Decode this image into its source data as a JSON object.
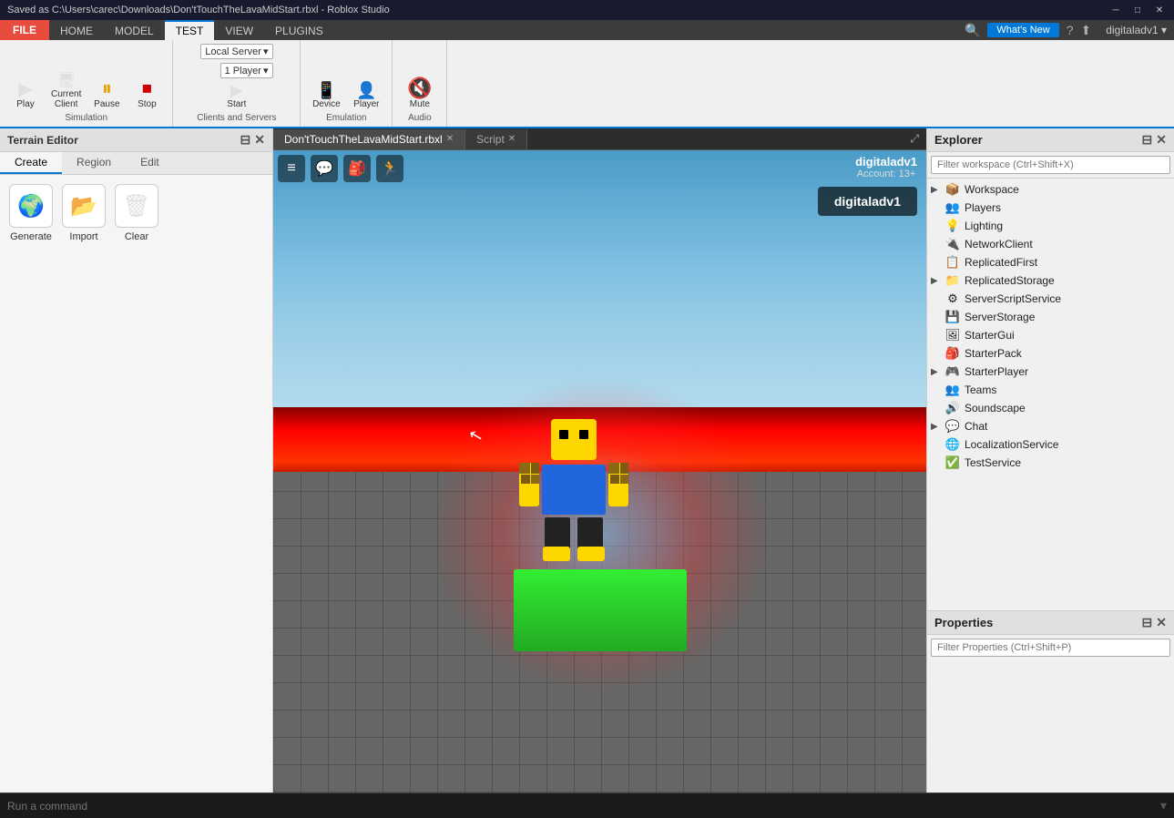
{
  "window": {
    "title": "Saved as C:\\Users\\carec\\Downloads\\Don'tTouchTheLavaMidStart.rbxl - Roblox Studio",
    "minimize": "─",
    "maximize": "□",
    "close": "✕"
  },
  "top_area": {
    "file_label": "FILE",
    "whats_new": "What's New",
    "help_icon": "?",
    "share_icon": "⬆",
    "user": "digitaladv1 ▾"
  },
  "menu": {
    "tabs": [
      "HOME",
      "MODEL",
      "TEST",
      "VIEW",
      "PLUGINS"
    ],
    "active": "TEST"
  },
  "ribbon": {
    "simulation": {
      "label": "Simulation",
      "play": {
        "label": "Play",
        "icon": "▶"
      },
      "current_client": {
        "label": "Current\nClient",
        "icon": "🖥"
      },
      "pause": {
        "label": "Pause",
        "icon": "⏸"
      },
      "stop": {
        "label": "Stop",
        "icon": "⏹"
      }
    },
    "clients_servers": {
      "label": "Clients and Servers",
      "local_server": "Local Server",
      "players": "1 Player",
      "start": {
        "label": "Start",
        "icon": "▶"
      }
    },
    "emulation": {
      "label": "Emulation",
      "device": {
        "label": "Device",
        "icon": "📱"
      },
      "player": {
        "label": "Player",
        "icon": "👤"
      }
    },
    "audio": {
      "label": "Audio",
      "mute": {
        "label": "Mute",
        "icon": "🔇"
      }
    }
  },
  "terrain_editor": {
    "title": "Terrain Editor",
    "tabs": [
      "Create",
      "Region",
      "Edit"
    ],
    "active_tab": "Create",
    "tools": [
      {
        "id": "generate",
        "label": "Generate",
        "icon": "🌍"
      },
      {
        "id": "import",
        "label": "Import",
        "icon": "📂"
      },
      {
        "id": "clear",
        "label": "Clear",
        "icon": "🗑"
      }
    ]
  },
  "viewport": {
    "tabs": [
      {
        "label": "Don'tTouchTheLavaMidStart.rbxl",
        "closeable": true
      },
      {
        "label": "Script",
        "closeable": true
      }
    ],
    "active_tab": 0,
    "ingame": {
      "username": "digitaladv1",
      "account_label": "Account: 13+",
      "button_label": "digitaladv1"
    },
    "toolbar_icons": [
      "≡",
      "💬",
      "🎒",
      "🏃"
    ]
  },
  "explorer": {
    "title": "Explorer",
    "filter_placeholder": "Filter workspace (Ctrl+Shift+X)",
    "items": [
      {
        "label": "Workspace",
        "icon": "📦",
        "expandable": true,
        "indent": 0
      },
      {
        "label": "Players",
        "icon": "👥",
        "expandable": false,
        "indent": 0
      },
      {
        "label": "Lighting",
        "icon": "💡",
        "expandable": false,
        "indent": 0
      },
      {
        "label": "NetworkClient",
        "icon": "🔌",
        "expandable": false,
        "indent": 0
      },
      {
        "label": "ReplicatedFirst",
        "icon": "📋",
        "expandable": false,
        "indent": 0
      },
      {
        "label": "ReplicatedStorage",
        "icon": "📁",
        "expandable": true,
        "indent": 0
      },
      {
        "label": "ServerScriptService",
        "icon": "⚙",
        "expandable": false,
        "indent": 0
      },
      {
        "label": "ServerStorage",
        "icon": "💾",
        "expandable": false,
        "indent": 0
      },
      {
        "label": "StarterGui",
        "icon": "🖼",
        "expandable": false,
        "indent": 0
      },
      {
        "label": "StarterPack",
        "icon": "🎒",
        "expandable": false,
        "indent": 0
      },
      {
        "label": "StarterPlayer",
        "icon": "🎮",
        "expandable": true,
        "indent": 0
      },
      {
        "label": "Teams",
        "icon": "👥",
        "expandable": false,
        "indent": 0
      },
      {
        "label": "Soundscape",
        "icon": "🔊",
        "expandable": false,
        "indent": 0
      },
      {
        "label": "Chat",
        "icon": "💬",
        "expandable": true,
        "indent": 0
      },
      {
        "label": "LocalizationService",
        "icon": "🌐",
        "expandable": false,
        "indent": 0
      },
      {
        "label": "TestService",
        "icon": "✅",
        "expandable": false,
        "indent": 0
      }
    ]
  },
  "properties": {
    "title": "Properties",
    "filter_placeholder": "Filter Properties (Ctrl+Shift+P)"
  },
  "bottom_bar": {
    "command_placeholder": "Run a command"
  }
}
